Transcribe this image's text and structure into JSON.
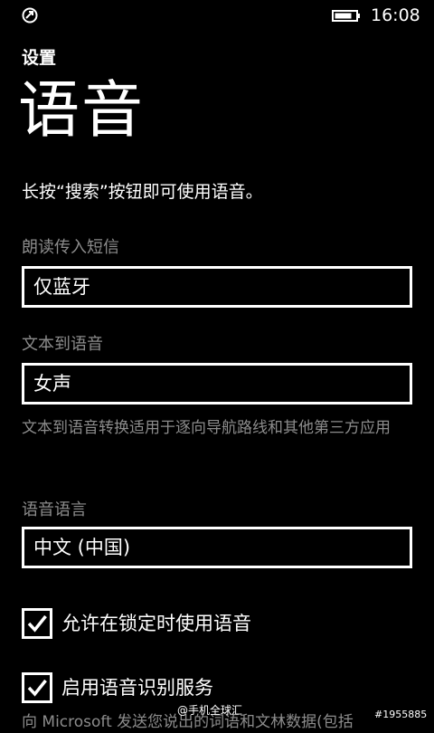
{
  "status_bar": {
    "left_icon": "circle-arrow-icon",
    "battery_icon": "battery-icon",
    "time": "16:08"
  },
  "header": {
    "app_title": "设置",
    "page_title": "语音"
  },
  "hint": "长按“搜索”按钮即可使用语音。",
  "read_sms": {
    "label": "朗读传入短信",
    "value": "仅蓝牙"
  },
  "tts": {
    "label": "文本到语音",
    "value": "女声",
    "description": "文本到语音转换适用于逐向导航路线和其他第三方应用"
  },
  "speech_language": {
    "label": "语音语言",
    "value": "中文 (中国)"
  },
  "options": [
    {
      "label": "允许在锁定时使用语音",
      "checked": true
    },
    {
      "label": "启用语音识别服务",
      "checked": true
    }
  ],
  "cut_off_text": "向 Microsoft 发送您说出的词语和文林数据(包括",
  "watermark": {
    "text": "@手机全球汇",
    "id": "#1955885"
  },
  "colors": {
    "background": "#000000",
    "foreground": "#ffffff",
    "subtle": "#8c8c8c"
  }
}
